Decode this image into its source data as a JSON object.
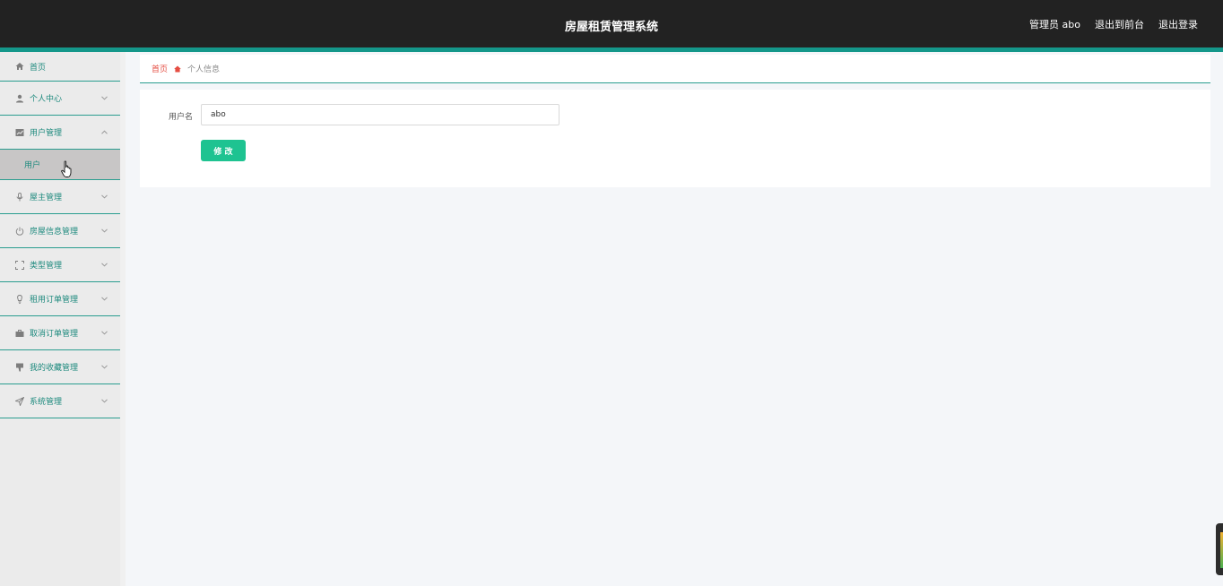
{
  "header": {
    "title": "房屋租赁管理系统",
    "admin_label": "管理员 abo",
    "front_link": "退出到前台",
    "logout_link": "退出登录"
  },
  "sidebar": {
    "items": [
      {
        "label": "首页",
        "icon": "home-icon"
      },
      {
        "label": "个人中心",
        "icon": "user-icon"
      },
      {
        "label": "用户管理",
        "icon": "chart-icon",
        "expanded": true,
        "sub_items": [
          {
            "label": "用户"
          }
        ]
      },
      {
        "label": "屋主管理",
        "icon": "microphone-icon"
      },
      {
        "label": "房屋信息管理",
        "icon": "power-icon"
      },
      {
        "label": "类型管理",
        "icon": "expand-icon"
      },
      {
        "label": "租用订单管理",
        "icon": "bulb-icon"
      },
      {
        "label": "取消订单管理",
        "icon": "briefcase-icon"
      },
      {
        "label": "我的收藏管理",
        "icon": "thumbs-down-icon"
      },
      {
        "label": "系统管理",
        "icon": "send-icon"
      }
    ]
  },
  "breadcrumb": {
    "home": "首页",
    "current": "个人信息"
  },
  "form": {
    "username_label": "用户名",
    "username_value": "abo",
    "submit_label": "修 改"
  },
  "colors": {
    "topbar": "#222222",
    "accent": "#14978a",
    "nav_text": "#1e8a7e",
    "button": "#1ec391",
    "breadcrumb_home": "#e54d42"
  }
}
